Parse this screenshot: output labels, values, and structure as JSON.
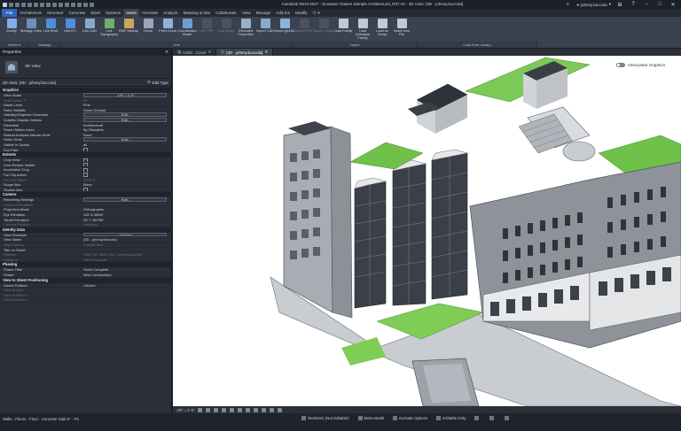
{
  "window": {
    "title": "Autodesk Revit 2027 - Snowdon Towers Sample Architectural_R27.rvt - 3D View: {3D - johnny.buccola}",
    "user": "johnny.buccola"
  },
  "tabs": [
    "File",
    "Architecture",
    "Structure",
    "Concrete",
    "Steel",
    "Systems",
    "Insert",
    "Annotate",
    "Analyze",
    "Massing & Site",
    "Collaborate",
    "View",
    "Manage",
    "Add-Ins",
    "Modify",
    "Ⓒ ▾"
  ],
  "active_tab": "Insert",
  "ribbon": {
    "tools": [
      {
        "label": "Modify",
        "color": "#7fb0e8",
        "dim": false
      },
      {
        "label": "Manage Links",
        "color": "#6f8fb8",
        "dim": false
      },
      {
        "label": "Link Revit",
        "color": "#4f8fd8",
        "dim": false
      },
      {
        "label": "Link IFC",
        "color": "#4f8fd8",
        "dim": false
      },
      {
        "label": "Link CAD",
        "color": "#89a9cc",
        "dim": false
      },
      {
        "label": "Link Topography",
        "color": "#6fb06f",
        "dim": false
      },
      {
        "label": "DWF Markup",
        "color": "#c9a65a",
        "dim": false
      },
      {
        "label": "Decal",
        "color": "#9aa7b8",
        "dim": false
      },
      {
        "label": "Point Cloud",
        "color": "#8db3d8",
        "dim": false
      },
      {
        "label": "Coordination Model",
        "color": "#6a9fd0",
        "dim": false
      },
      {
        "label": "Link PDF",
        "color": "#6b7380",
        "dim": true
      },
      {
        "label": "Link Image",
        "color": "#6b7380",
        "dim": true
      },
      {
        "label": "Extended Properties",
        "color": "#9ab0c8",
        "dim": false
      },
      {
        "label": "Import CAD",
        "color": "#89a9cc",
        "dim": false
      },
      {
        "label": "Import gbXML",
        "color": "#8db3d8",
        "dim": false
      },
      {
        "label": "Import PDF",
        "color": "#6b7380",
        "dim": true
      },
      {
        "label": "Import Image",
        "color": "#6b7380",
        "dim": true
      },
      {
        "label": "Load Family",
        "color": "#c0cad6",
        "dim": false
      },
      {
        "label": "Load Autodesk Family",
        "color": "#c0cad6",
        "dim": false
      },
      {
        "label": "Load as Group",
        "color": "#c0cad6",
        "dim": false
      },
      {
        "label": "Insert from File",
        "color": "#c0cad6",
        "dim": false
      }
    ],
    "groups": [
      {
        "label": "Select ▾",
        "width": 22
      },
      {
        "label": "Manage",
        "width": 24
      },
      {
        "label": "Link",
        "width": 174
      },
      {
        "label": "Import",
        "width": 94
      },
      {
        "label": "Load from Library",
        "width": 90
      }
    ]
  },
  "properties": {
    "panel_title": "Properties",
    "type_name": "3D View",
    "selector": "3D View: {3D - johnny.buccola}",
    "edit_type": "Edit Type",
    "apply": "Apply",
    "help": "Properties help",
    "sections": [
      {
        "title": "Graphics",
        "rows": [
          {
            "k": "View Scale",
            "v": "1/8\" = 1'-0\"",
            "t": "box"
          },
          {
            "k": "Scale Value 1:",
            "v": "96",
            "t": "dim"
          },
          {
            "k": "Detail Level",
            "v": "Fine"
          },
          {
            "k": "Parts Visibility",
            "v": "Show Original"
          },
          {
            "k": "Visibility/Graphics Overrides",
            "v": "Edit...",
            "t": "box"
          },
          {
            "k": "Graphic Display Options",
            "v": "Edit...",
            "t": "box"
          },
          {
            "k": "Discipline",
            "v": "Architectural"
          },
          {
            "k": "Show Hidden Lines",
            "v": "By Discipline"
          },
          {
            "k": "Default Analysis Display Style",
            "v": "None"
          },
          {
            "k": "Show Grids",
            "v": "Edit...",
            "t": "box"
          },
          {
            "k": "Visible In Option",
            "v": "all"
          },
          {
            "k": "Sun Path",
            "v": "",
            "t": "chk"
          }
        ]
      },
      {
        "title": "Extents",
        "rows": [
          {
            "k": "Crop View",
            "v": "",
            "t": "chk"
          },
          {
            "k": "Crop Region Visible",
            "v": "",
            "t": "chk"
          },
          {
            "k": "Annotation Crop",
            "v": "",
            "t": "chk"
          },
          {
            "k": "Far Clip Active",
            "v": "",
            "t": "chk"
          },
          {
            "k": "Far Clip Offset",
            "v": "1000' 0\"",
            "t": "dim"
          },
          {
            "k": "Scope Box",
            "v": "None"
          },
          {
            "k": "Section Box",
            "v": "",
            "t": "chk"
          }
        ]
      },
      {
        "title": "Camera",
        "rows": [
          {
            "k": "Rendering Settings",
            "v": "Edit...",
            "t": "box"
          },
          {
            "k": "Locked Orientation",
            "v": "",
            "t": "dim"
          },
          {
            "k": "Projection Mode",
            "v": "Orthographic"
          },
          {
            "k": "Eye Elevation",
            "v": "115' 8 45/64\""
          },
          {
            "k": "Target Elevation",
            "v": "26' 7 45/256\""
          },
          {
            "k": "Camera Position",
            "v": "Adjusting",
            "t": "dim"
          }
        ]
      },
      {
        "title": "Identity Data",
        "rows": [
          {
            "k": "View Template",
            "v": "<None>",
            "t": "box"
          },
          {
            "k": "View Name",
            "v": "{3D - johnny.buccola}"
          },
          {
            "k": "Dependency",
            "v": "Independent",
            "t": "dim"
          },
          {
            "k": "Title on Sheet",
            "v": ""
          },
          {
            "k": "Workset",
            "v": "View \"3D View: {3D - johnny.buccola}\"",
            "t": "dim"
          },
          {
            "k": "Edited by",
            "v": "johnny.buccola",
            "t": "dim"
          }
        ]
      },
      {
        "title": "Phasing",
        "rows": [
          {
            "k": "Phase Filter",
            "v": "Show Complete"
          },
          {
            "k": "Phase",
            "v": "New Construction"
          }
        ]
      },
      {
        "title": "View to Sheet Positioning",
        "rows": [
          {
            "k": "Saved Position",
            "v": "<None>"
          },
          {
            "k": "View Anchor",
            "v": "",
            "t": "dim"
          },
          {
            "k": "View Position X",
            "v": "",
            "t": "dim"
          },
          {
            "k": "View Position Y",
            "v": "",
            "t": "dim"
          }
        ]
      }
    ]
  },
  "view_tabs": [
    {
      "label": "G000 - Cover",
      "active": false
    },
    {
      "label": "{3D - johnny.buccola}",
      "active": true
    }
  ],
  "viewport": {
    "toggle_label": "Associated Graphics",
    "scale": "1/8\" = 1'-0\""
  },
  "status": {
    "hint": "Walls : Floors : Floor : Concrete Slab 6\" - P1",
    "workset": "Workset1 (Not Editable)",
    "model": "Main Model",
    "exclude": "Exclude Options",
    "editable": "Editable Only"
  },
  "colors": {
    "accent": "#2c67c2",
    "roof_green": "#6fc14a",
    "facade_grey": "#9aa0a8",
    "glazing": "#3b4048"
  }
}
